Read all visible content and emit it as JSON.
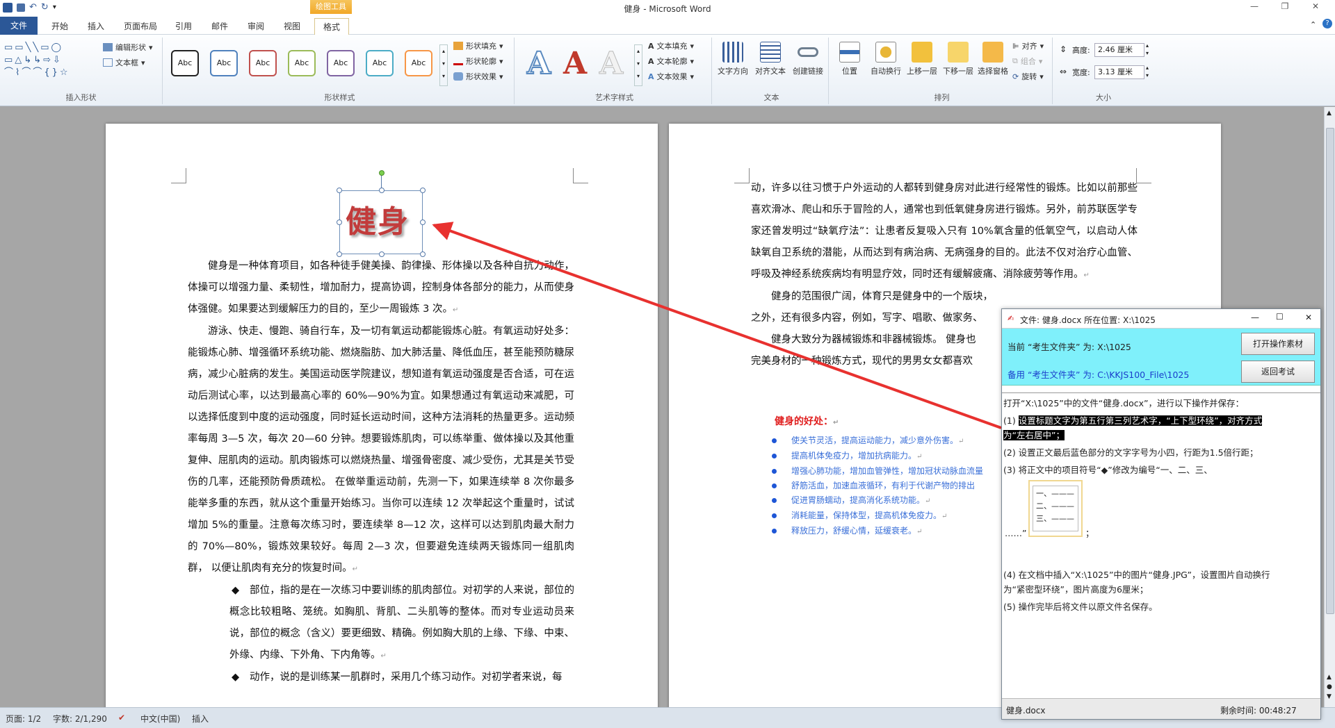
{
  "titlebar": {
    "title": "健身 - Microsoft Word",
    "context_tool": "绘图工具",
    "min": "—",
    "max": "❐",
    "close": "✕"
  },
  "tabs": [
    "文件",
    "开始",
    "插入",
    "页面布局",
    "引用",
    "邮件",
    "审阅",
    "视图",
    "格式"
  ],
  "ribbon": {
    "insert_shapes": {
      "label": "插入形状",
      "edit_shape": "编辑形状",
      "textbox": "文本框"
    },
    "shape_styles": {
      "label": "形状样式",
      "sample": "Abc",
      "fill": "形状填充",
      "outline": "形状轮廓",
      "effect": "形状效果"
    },
    "wordart": {
      "label": "艺术字样式",
      "glyph": "A",
      "text_fill": "文本填充",
      "text_outline": "文本轮廓",
      "text_effect": "文本效果"
    },
    "text": {
      "label": "文本",
      "direction": "文字方向",
      "align": "对齐文本",
      "link": "创建链接"
    },
    "arrange": {
      "label": "排列",
      "position": "位置",
      "wrap": "自动换行",
      "forward": "上移一层",
      "backward": "下移一层",
      "pane": "选择窗格",
      "align": "对齐",
      "group": "组合",
      "rotate": "旋转"
    },
    "size": {
      "label": "大小",
      "height_label": "高度:",
      "height": "2.46 厘米",
      "width_label": "宽度:",
      "width": "3.13 厘米"
    }
  },
  "doc": {
    "art_title": "健身",
    "left_paras": [
      "健身是一种体育项目，如各种徒手健美操、韵律操、形体操以及各种自抗力动作，体操可以增强力量、柔韧性，增加耐力，提高协调，控制身体各部分的能力，从而使身体强健。如果要达到缓解压力的目的，至少一周锻炼 3 次。",
      "游泳、快走、慢跑、骑自行车，及一切有氧运动都能锻炼心脏。有氧运动好处多：能锻炼心肺、增强循环系统功能、燃烧脂肪、加大肺活量、降低血压，甚至能预防糖尿病，减少心脏病的发生。美国运动医学院建议，想知道有氧运动强度是否合适，可在运动后测试心率，以达到最高心率的 60%—90%为宜。如果想通过有氧运动来减肥，可以选择低度到中度的运动强度，同时延长运动时间，这种方法消耗的热量更多。运动频率每周 3—5 次，每次 20—60 分钟。想要锻炼肌肉，可以练举重、做体操以及其他重复伸、屈肌肉的运动。肌肉锻炼可以燃烧热量、增强骨密度、减少受伤，尤其是关节受伤的几率，还能预防骨质疏松。 在做举重运动前，先测一下，如果连续举 8 次你最多能举多重的东西，就从这个重量开始练习。当你可以连续 12 次举起这个重量时，试试增加 5%的重量。注意每次练习时，要连续举 8—12 次，这样可以达到肌肉最大耐力的 70%—80%，锻炼效果较好。每周 2—3 次，但要避免连续两天锻炼同一组肌肉群， 以便让肌肉有充分的恢复时间。"
    ],
    "left_bullets": [
      "部位，指的是在一次练习中要训练的肌肉部位。对初学的人来说，部位的概念比较粗略、笼统。如胸肌、背肌、二头肌等的整体。而对专业运动员来说，部位的概念（含义）要更细致、精确。例如胸大肌的上缘、下缘、中束、外缘、内缘、下外角、下内角等。",
      "动作，说的是训练某一肌群时，采用几个练习动作。对初学者来说，每"
    ],
    "bullet_symbol": "◆",
    "para_mark": "↵",
    "right_paras": [
      "动，许多以往习惯于户外运动的人都转到健身房对此进行经常性的锻炼。比如以前那些喜欢滑冰、爬山和乐于冒险的人，通常也到低氧健身房进行锻炼。另外，前苏联医学专家还曾发明过“缺氧疗法”：让患者反复吸入只有 10%氧含量的低氧空气，以启动人体缺氧自卫系统的潜能，从而达到有病治病、无病强身的目的。此法不仅对治疗心血管、呼吸及神经系统疾病均有明显疗效，同时还有缓解疲痛、消除疲劳等作用。",
      "健身的范围很广阔，体育只是健身中的一个版块，",
      "之外，还有很多内容，例如，写字、唱歌、做家务、",
      "健身大致分为器械锻炼和非器械锻炼。 健身也",
      "完美身材的一种锻炼方式，现代的男男女女都喜欢"
    ],
    "benefit_title": "健身的好处：",
    "benefits": [
      "使关节灵活，提高运动能力，减少意外伤害。",
      "提高机体免疫力，增加抗病能力。",
      "增强心肺功能，增加血管弹性，增加冠状动脉血流量",
      "舒筋活血，加速血液循环，有利于代谢产物的排出",
      "促进胃肠蠕动，提高消化系统功能。",
      "消耗能量，保持体型，提高机体免疫力。",
      "释放压力，舒缓心情，延缓衰老。"
    ]
  },
  "exam": {
    "title": "文件: 健身.docx 所在位置: X:\\1025",
    "current": "当前 “考生文件夹” 为: X:\\1025",
    "backup": "备用 “考生文件夹” 为: C:\\KKJS100_File\\1025",
    "open_btn": "打开操作素材",
    "back_btn": "返回考试",
    "intro": "打开“X:\\1025”中的文件“健身.docx”，进行以下操作并保存：",
    "step1_a": "(1)",
    "step1_b": "设置标题文字为第五行第三列艺术字，“上下型环绕”，对齐方式",
    "step1_c": "为“左右居中”；",
    "step2": "(2) 设置正文最后蓝色部分的文字字号为小四，行距为1.5倍行距；",
    "step3": "(3) 将正文中的项目符号“◆”修改为编号“一、二、三、",
    "ex_items": [
      "一、",
      "二、",
      "三、"
    ],
    "ellipsis": "……”",
    "semi": "；",
    "step4a": "(4) 在文档中插入“X:\\1025”中的图片“健身.JPG”，设置图片自动换行",
    "step4b": "为“紧密型环绕”，图片高度为6厘米；",
    "step5": "(5) 操作完毕后将文件以原文件名保存。",
    "foot_file": "健身.docx",
    "timer": "剩余时间: 00:48:27"
  },
  "status": {
    "page": "页面: 1/2",
    "words": "字数: 2/1,290",
    "lang": "中文(中国)",
    "mode": "插入"
  },
  "colors": {
    "accent": "#2b5797",
    "arrow": "#e8312f",
    "exam_head": "#7ff0fb"
  }
}
